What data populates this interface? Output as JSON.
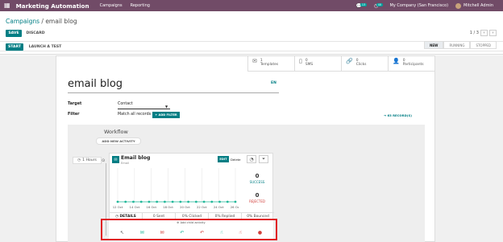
{
  "navbar": {
    "apps_icon": "grid-icon",
    "app_name": "Marketing Automation",
    "menu": [
      "Campaigns",
      "Reporting"
    ],
    "chat_count": "13",
    "activity_count": "40",
    "company": "My Company (San Francisco)",
    "user": "Mitchell Admin"
  },
  "breadcrumb": {
    "parent": "Campaigns",
    "separator": " / ",
    "current": "email blog"
  },
  "buttons": {
    "save": "SAVE",
    "discard": "DISCARD",
    "start": "START",
    "launch_test": "LAUNCH A TEST"
  },
  "pager": {
    "text": "1 / 3"
  },
  "statusbar": [
    "NEW",
    "RUNNING",
    "STOPPED"
  ],
  "stats": [
    {
      "icon": "envelope-icon",
      "value": "1",
      "label": "Templates"
    },
    {
      "icon": "mobile-icon",
      "value": "0",
      "label": "SMS"
    },
    {
      "icon": "link-icon",
      "value": "0",
      "label": "Clicks"
    },
    {
      "icon": "user-icon",
      "value": "0",
      "label": "Participants"
    }
  ],
  "form": {
    "title": "email blog",
    "lang": "EN",
    "target_label": "Target",
    "target_value": "Contact",
    "filter_label": "Filter",
    "filter_value": "Match all records",
    "add_filter": "+ ADD FILTER",
    "records": "63 RECORD(S)"
  },
  "workflow": {
    "title": "Workflow",
    "add_activity": "ADD NEW ACTIVITY",
    "delay": "1 Hours",
    "activity": {
      "name": "Email blog",
      "type": "Email",
      "edit": "EDIT",
      "delete": "Delete",
      "success_value": "0",
      "success_label": "SUCCESS",
      "rejected_value": "0",
      "rejected_label": "REJECTED",
      "footer": [
        "DETAILS",
        "0 Sent",
        "0% Clicked",
        "0% Replied",
        "0% Bounced"
      ]
    },
    "add_child": "Add child activity",
    "child_icons": [
      "cursor-icon",
      "envelope-open-icon",
      "envelope-icon",
      "reply-icon",
      "reply-red-icon",
      "hand-pointer-icon",
      "hand-red-icon",
      "bounce-icon"
    ]
  },
  "chart_data": {
    "type": "line",
    "categories": [
      "12 Oct",
      "14 Oct",
      "16 Oct",
      "18 Oct",
      "20 Oct",
      "22 Oct",
      "24 Oct",
      "26 Oct"
    ],
    "values": [
      0,
      0,
      0,
      0,
      0,
      0,
      0,
      0,
      0,
      0,
      0,
      0,
      0,
      0,
      0,
      0
    ],
    "color": "#21b799"
  }
}
